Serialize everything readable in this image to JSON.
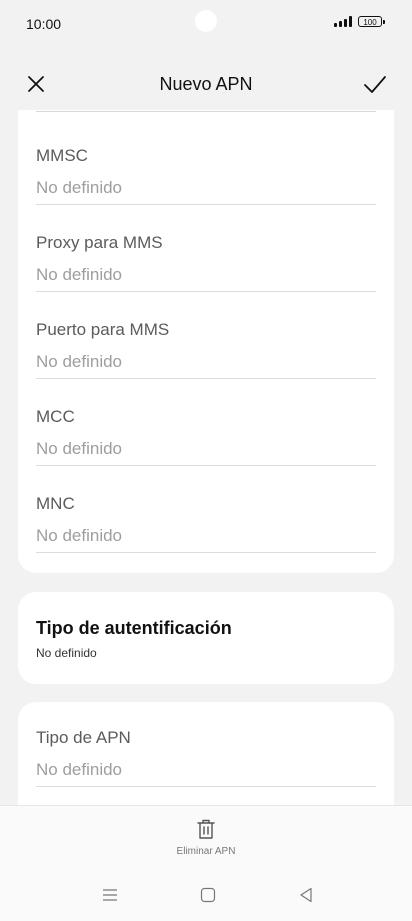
{
  "status_bar": {
    "time": "10:00",
    "battery": "100",
    "icons": [
      "signal-icon",
      "battery-icon"
    ]
  },
  "header": {
    "title": "Nuevo APN",
    "close_icon": "close-icon",
    "confirm_icon": "check-icon"
  },
  "fields": [
    {
      "label": "MMSC",
      "value": "No definido"
    },
    {
      "label": "Proxy para MMS",
      "value": "No definido"
    },
    {
      "label": "Puerto para MMS",
      "value": "No definido"
    },
    {
      "label": "MCC",
      "value": "No definido"
    },
    {
      "label": "MNC",
      "value": "No definido"
    }
  ],
  "auth": {
    "label": "Tipo de autentificación",
    "value": "No definido"
  },
  "apn_type": {
    "label": "Tipo de APN",
    "value": "No definido"
  },
  "bottom": {
    "delete_label": "Eliminar APN",
    "delete_icon": "trash-icon"
  },
  "nav": {
    "icons": [
      "menu-icon",
      "home-icon",
      "back-icon"
    ]
  }
}
